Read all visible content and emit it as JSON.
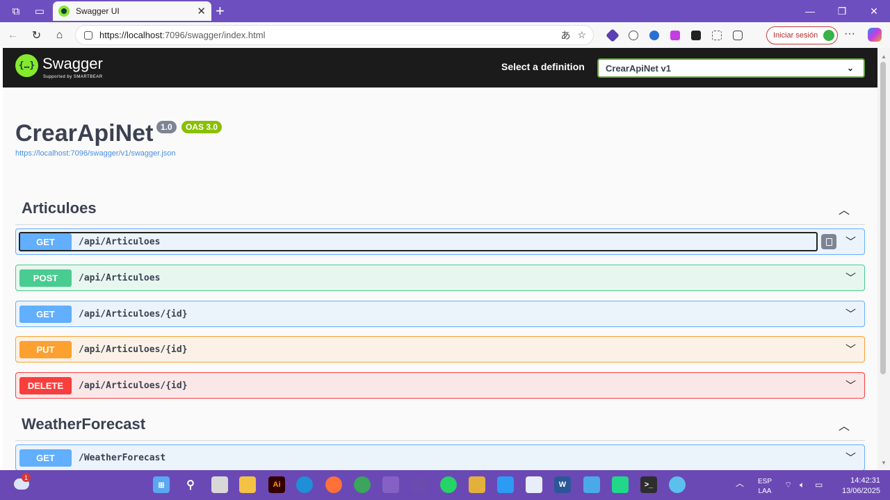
{
  "browser": {
    "tab_title": "Swagger UI",
    "url_host": "https://localhost",
    "url_rest": ":7096/swagger/index.html",
    "signin_label": "Iniciar sesión"
  },
  "swagger": {
    "logo_name": "Swagger",
    "logo_sub": "Supported by SMARTBEAR",
    "definition_label": "Select a definition",
    "definition_value": "CrearApiNet v1"
  },
  "info": {
    "title": "CrearApiNet",
    "version": "1.0",
    "oas": "OAS 3.0",
    "spec_url": "https://localhost:7096/swagger/v1/swagger.json"
  },
  "sections": [
    {
      "name": "Articuloes",
      "operations": [
        {
          "method": "GET",
          "path": "/api/Articuloes"
        },
        {
          "method": "POST",
          "path": "/api/Articuloes"
        },
        {
          "method": "GET",
          "path": "/api/Articuloes/{id}"
        },
        {
          "method": "PUT",
          "path": "/api/Articuloes/{id}"
        },
        {
          "method": "DELETE",
          "path": "/api/Articuloes/{id}"
        }
      ]
    },
    {
      "name": "WeatherForecast",
      "operations": [
        {
          "method": "GET",
          "path": "/WeatherForecast"
        }
      ]
    }
  ],
  "taskbar": {
    "notification_count": "1",
    "lang_top": "ESP",
    "lang_bottom": "LAA",
    "time": "14:42:31",
    "date": "13/06/2025"
  },
  "colors": {
    "get": "#61affe",
    "post": "#49cc90",
    "put": "#fca130",
    "delete": "#f93e3e",
    "swagger_green": "#85ea2d",
    "browser_accent": "#6e4fc0"
  }
}
